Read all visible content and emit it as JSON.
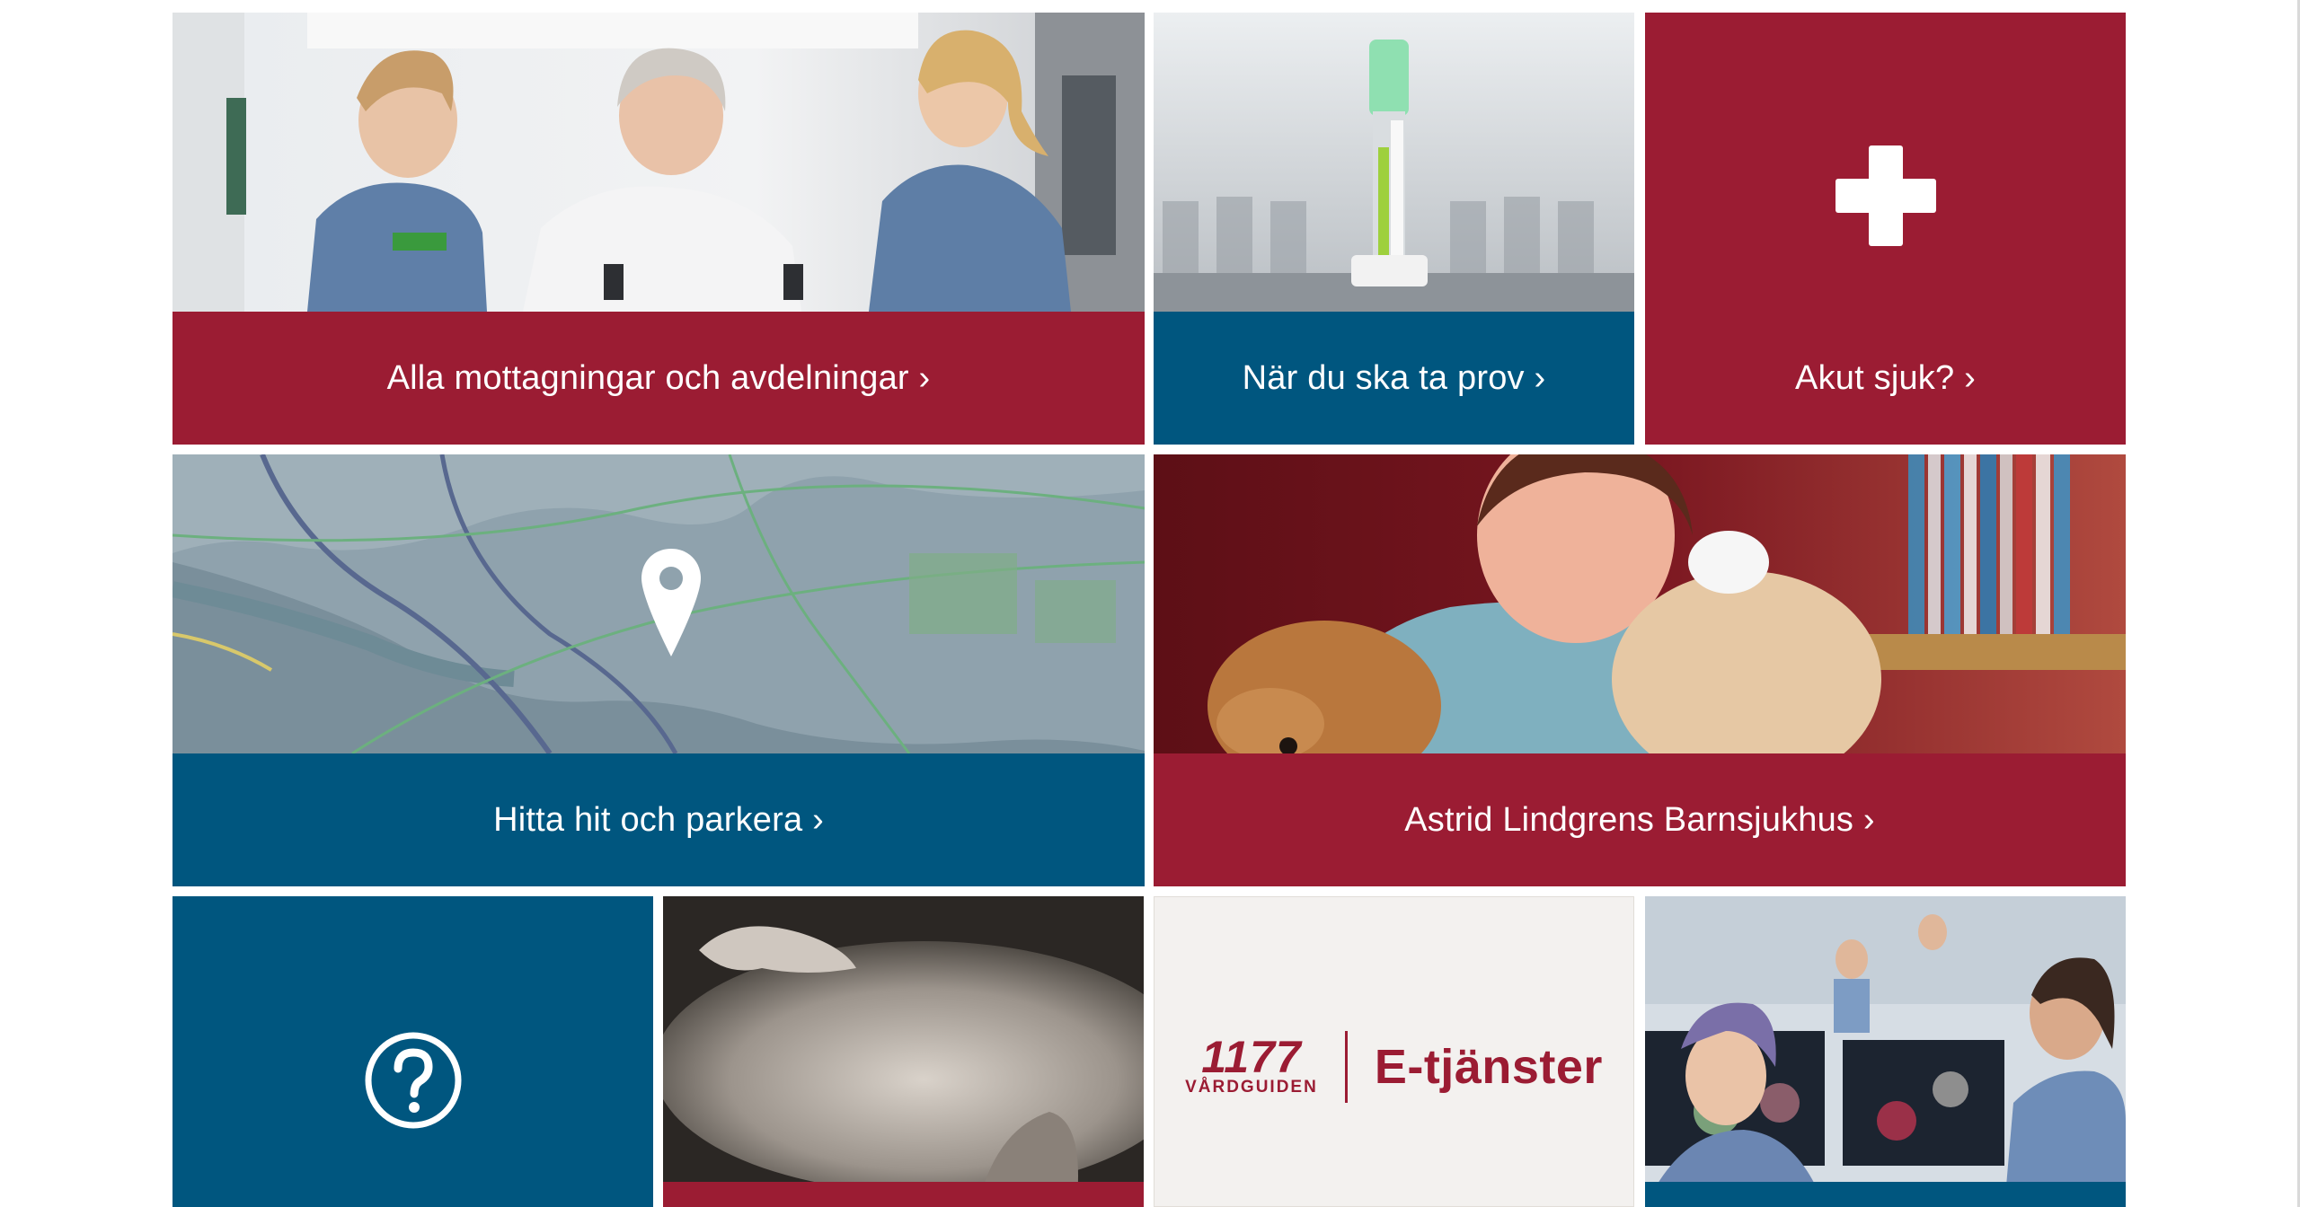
{
  "tiles": {
    "mottagningar": {
      "label": "Alla mottagningar och avdelningar ›"
    },
    "prov": {
      "label": "När du ska ta prov ›"
    },
    "akut": {
      "label": "Akut sjuk? ›"
    },
    "hitta": {
      "label": "Hitta hit och parkera ›"
    },
    "barnsjukhus": {
      "label": "Astrid Lindgrens Barnsjukhus ›"
    },
    "etjanster": {
      "logo_number": "1177",
      "logo_sub": "VÅRDGUIDEN",
      "logo_service": "E-tjänster"
    }
  },
  "colors": {
    "red": "#9b1c33",
    "blue": "#00567f",
    "light_panel": "#f3f1ef"
  },
  "icons": {
    "akut": "plus-cross-icon",
    "hitta": "map-pin-icon",
    "faq": "question-circle-icon"
  }
}
